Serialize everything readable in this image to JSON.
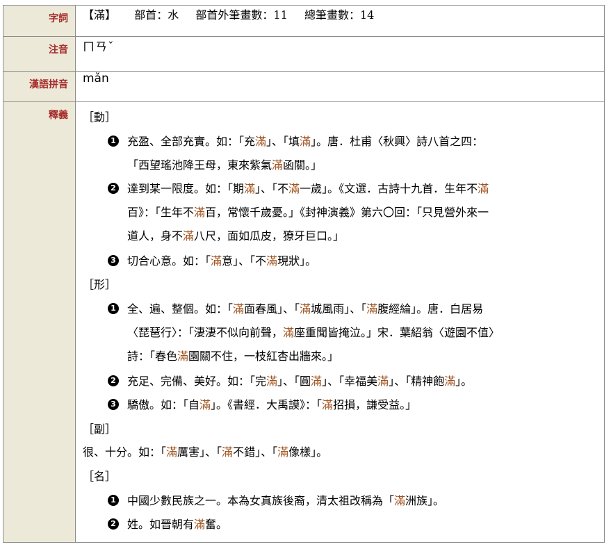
{
  "labels": {
    "ziCi": "字詞",
    "zhuyin": "注音",
    "pinyin": "漢語拼音",
    "shiyi": "釋義"
  },
  "head": {
    "word": "【滿】",
    "bushou": "部首：水",
    "waibihua": "部首外筆畫數：11",
    "zongbihua": "總筆畫數：14"
  },
  "zhuyin": "ㄇㄢˇ",
  "pinyin": "mǎn",
  "pos": {
    "verb": "［動］",
    "adj": "［形］",
    "adv": "［副］",
    "noun": "［名］"
  },
  "bullets": [
    "1",
    "2",
    "3"
  ],
  "verb": {
    "d1": {
      "l1a": "充盈、全部充實。如：「充",
      "l1b": "滿",
      "l1c": "」、「填",
      "l1d": "滿",
      "l1e": "」。唐．杜甫〈秋興〉詩八首之四：",
      "l2a": "「西望瑤池降王母，東來紫氣",
      "l2b": "滿",
      "l2c": "函關。」"
    },
    "d2": {
      "l1a": "達到某一限度。如：「期",
      "l1b": "滿",
      "l1c": "」、「不",
      "l1d": "滿",
      "l1e": "一歲」。《文選．古詩十九首．生年不",
      "l1f": "滿",
      "l2a": "百》：「生年不",
      "l2b": "滿",
      "l2c": "百，常懷千歲憂。」《封神演義》第六〇回：「只見營外來一",
      "l3a": "道人，身不",
      "l3b": "滿",
      "l3c": "八尺，面如瓜皮，獠牙巨口。」"
    },
    "d3": {
      "l1a": "切合心意。如：「",
      "l1b": "滿",
      "l1c": "意」、「不",
      "l1d": "滿",
      "l1e": "現狀」。"
    }
  },
  "adj": {
    "d1": {
      "l1a": "全、遍、整個。如：「",
      "l1b": "滿",
      "l1c": "面春風」、「",
      "l1d": "滿",
      "l1e": "城風雨」、「",
      "l1f": "滿",
      "l1g": "腹經綸」。唐．白居易",
      "l2a": "〈琵琶行〉：「淒淒不似向前聲，",
      "l2b": "滿",
      "l2c": "座重聞皆掩泣。」宋．葉紹翁〈遊園不值〉",
      "l3a": "詩：「春色",
      "l3b": "滿",
      "l3c": "園關不住，一枝紅杏出牆來。」"
    },
    "d2": {
      "l1a": "充足、完備、美好。如：「完",
      "l1b": "滿",
      "l1c": "」、「圓",
      "l1d": "滿",
      "l1e": "」、「幸福美",
      "l1f": "滿",
      "l1g": "」、「精神飽",
      "l1h": "滿",
      "l1i": "」。"
    },
    "d3": {
      "l1a": "驕傲。如：「自",
      "l1b": "滿",
      "l1c": "」。《書經．大禹謨》：「",
      "l1d": "滿",
      "l1e": "招損，謙受益。」"
    }
  },
  "adv": {
    "l1a": "很、十分。如：「",
    "l1b": "滿",
    "l1c": "厲害」、「",
    "l1d": "滿",
    "l1e": "不錯」、「",
    "l1f": "滿",
    "l1g": "像樣」。"
  },
  "noun": {
    "d1": {
      "l1a": "中國少數民族之一。本為女真族後裔，清太祖改稱為「",
      "l1b": "滿",
      "l1c": "洲族」。"
    },
    "d2": {
      "l1a": "姓。如晉朝有",
      "l1b": "滿",
      "l1c": "奮。"
    }
  }
}
